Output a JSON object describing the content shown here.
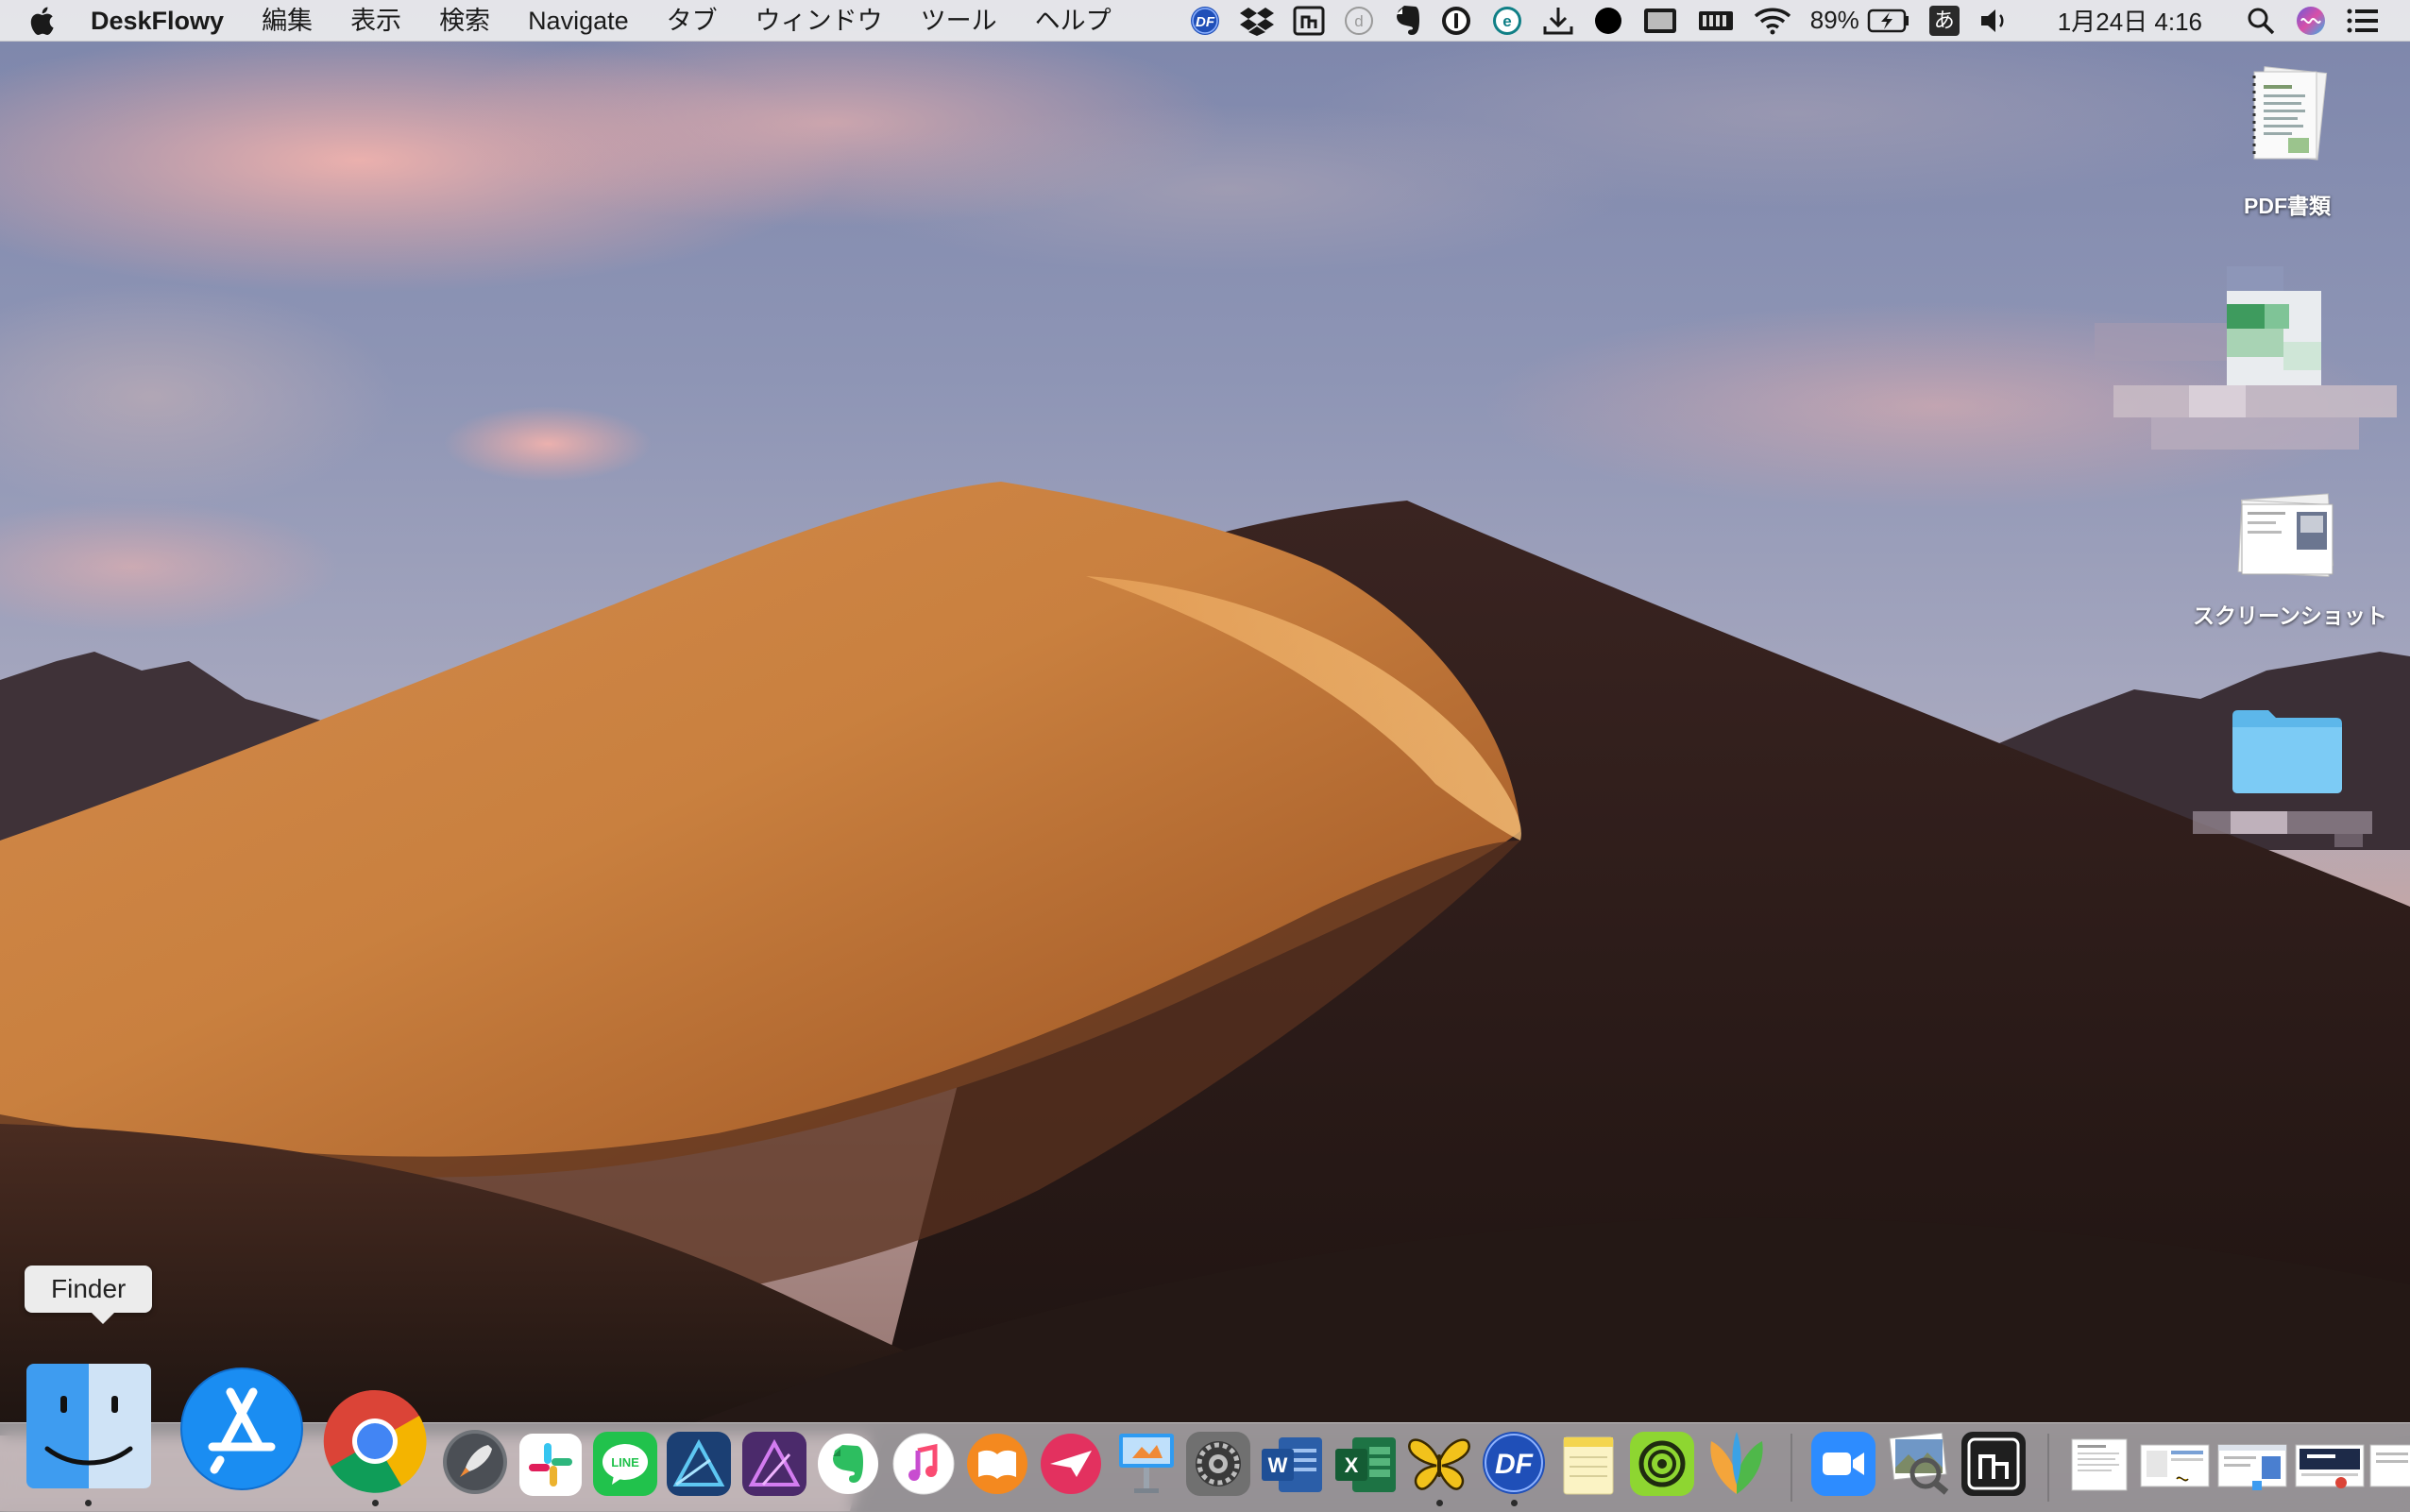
{
  "menubar": {
    "app_name": "DeskFlowy",
    "menus": [
      "編集",
      "表示",
      "検索",
      "Navigate",
      "タブ",
      "ウィンドウ",
      "ツール",
      "ヘルプ"
    ],
    "status_items": [
      {
        "name": "deskflowy-menu-icon",
        "label": "DF"
      },
      {
        "name": "dropbox-icon"
      },
      {
        "name": "nimbus-icon"
      },
      {
        "name": "d-circle-icon",
        "label": "d"
      },
      {
        "name": "evernote-icon"
      },
      {
        "name": "onepassword-icon"
      },
      {
        "name": "e-circle-icon",
        "label": "e"
      },
      {
        "name": "download-icon"
      },
      {
        "name": "black-circle-icon"
      },
      {
        "name": "display-icon"
      },
      {
        "name": "memory-icon"
      },
      {
        "name": "wifi-icon"
      }
    ],
    "battery_percent": "89%",
    "input_method": "あ",
    "clock": "1月24日  4:16"
  },
  "desktop": {
    "icons": [
      {
        "name": "pdf-folder",
        "label": "PDF書類"
      },
      {
        "name": "screenshot-stack",
        "label": "スクリーンショット"
      },
      {
        "name": "blue-folder",
        "label": ""
      }
    ]
  },
  "tooltip": {
    "text": "Finder"
  },
  "dock": {
    "apps": [
      {
        "name": "finder",
        "running": true
      },
      {
        "name": "app-store",
        "running": false
      },
      {
        "name": "chrome",
        "running": true
      },
      {
        "name": "launchpad",
        "running": false
      },
      {
        "name": "slack",
        "running": false
      },
      {
        "name": "line",
        "running": false
      },
      {
        "name": "affinity-designer",
        "running": false
      },
      {
        "name": "affinity-photo",
        "running": false
      },
      {
        "name": "evernote",
        "running": false
      },
      {
        "name": "itunes",
        "running": false
      },
      {
        "name": "books",
        "running": false
      },
      {
        "name": "airmail",
        "running": false
      },
      {
        "name": "keynote",
        "running": false
      },
      {
        "name": "system-preferences",
        "running": false
      },
      {
        "name": "word",
        "running": false
      },
      {
        "name": "excel",
        "running": false
      },
      {
        "name": "tes-butterfly",
        "running": true
      },
      {
        "name": "deskflowy",
        "running": true
      },
      {
        "name": "notes",
        "running": false
      },
      {
        "name": "scrivener-swirl",
        "running": false
      },
      {
        "name": "mindnode",
        "running": false
      },
      {
        "name": "zoom",
        "running": false
      },
      {
        "name": "preview",
        "running": false
      },
      {
        "name": "nimbus",
        "running": false
      }
    ],
    "colors": {
      "finder": "#3e9cf0",
      "appstore": "#1a8df2",
      "line": "#21c24c",
      "excel": "#1d7344",
      "word": "#2b5ea8",
      "zoom": "#2d8cff"
    }
  }
}
